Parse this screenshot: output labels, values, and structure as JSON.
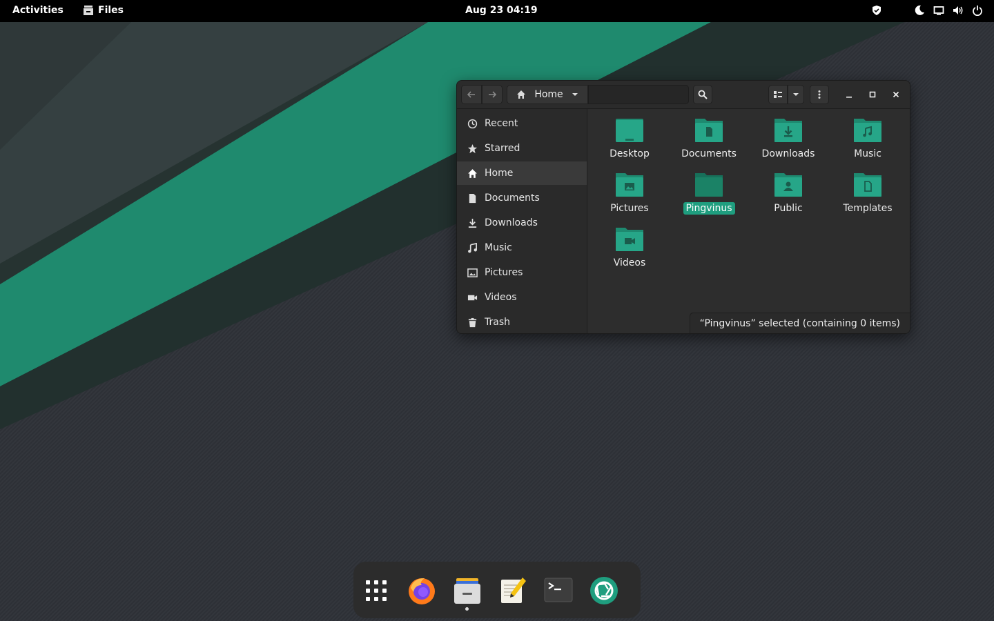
{
  "topbar": {
    "activities": "Activities",
    "app_name": "Files",
    "clock": "Aug 23  04:19",
    "tray_icons": [
      "shield-icon",
      "night-light-icon",
      "screen-icon",
      "volume-icon",
      "power-icon"
    ]
  },
  "window": {
    "path_label": "Home",
    "search_icon": "search-icon",
    "sidebar": [
      {
        "label": "Recent",
        "icon": "clock-icon",
        "active": false
      },
      {
        "label": "Starred",
        "icon": "star-icon",
        "active": false
      },
      {
        "label": "Home",
        "icon": "home-icon",
        "active": true
      },
      {
        "label": "Documents",
        "icon": "document-icon",
        "active": false
      },
      {
        "label": "Downloads",
        "icon": "download-icon",
        "active": false
      },
      {
        "label": "Music",
        "icon": "music-icon",
        "active": false
      },
      {
        "label": "Pictures",
        "icon": "picture-icon",
        "active": false
      },
      {
        "label": "Videos",
        "icon": "video-icon",
        "active": false
      },
      {
        "label": "Trash",
        "icon": "trash-icon",
        "active": false
      }
    ],
    "files": [
      {
        "label": "Desktop",
        "icon": "desktop-folder-icon",
        "selected": false
      },
      {
        "label": "Documents",
        "icon": "documents-folder-icon",
        "selected": false
      },
      {
        "label": "Downloads",
        "icon": "downloads-folder-icon",
        "selected": false
      },
      {
        "label": "Music",
        "icon": "music-folder-icon",
        "selected": false
      },
      {
        "label": "Pictures",
        "icon": "pictures-folder-icon",
        "selected": false
      },
      {
        "label": "Pingvinus",
        "icon": "folder-icon",
        "selected": true
      },
      {
        "label": "Public",
        "icon": "public-folder-icon",
        "selected": false
      },
      {
        "label": "Templates",
        "icon": "templates-folder-icon",
        "selected": false
      },
      {
        "label": "Videos",
        "icon": "videos-folder-icon",
        "selected": false
      }
    ],
    "status": "“Pingvinus” selected  (containing 0 items)"
  },
  "dock": {
    "items": [
      "app-grid-icon",
      "firefox-icon",
      "files-icon",
      "text-editor-icon",
      "terminal-icon",
      "camera-app-icon"
    ]
  },
  "colors": {
    "accent": "#1f9e7f",
    "folder": "#26a688",
    "folder_dark": "#1e8a70",
    "topbar": "#000000"
  }
}
